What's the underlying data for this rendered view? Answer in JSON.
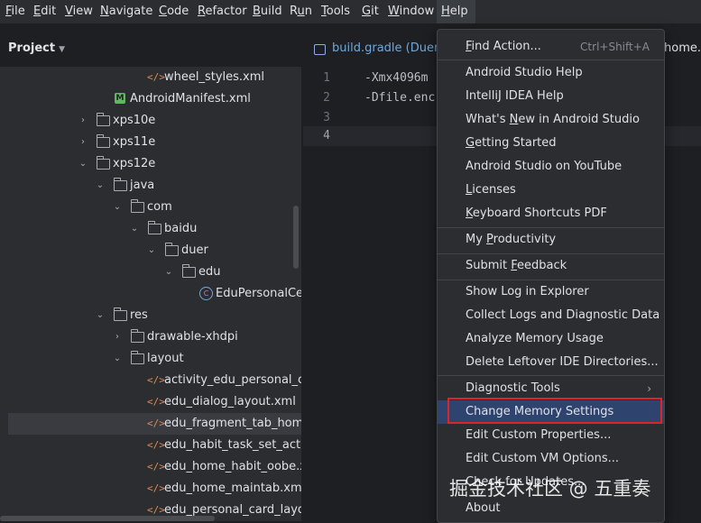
{
  "menubar": {
    "items": [
      {
        "pre": "",
        "mn": "F",
        "post": "ile"
      },
      {
        "pre": "",
        "mn": "E",
        "post": "dit"
      },
      {
        "pre": "",
        "mn": "V",
        "post": "iew"
      },
      {
        "pre": "",
        "mn": "N",
        "post": "avigate"
      },
      {
        "pre": "",
        "mn": "C",
        "post": "ode"
      },
      {
        "pre": "",
        "mn": "R",
        "post": "efactor"
      },
      {
        "pre": "",
        "mn": "B",
        "post": "uild"
      },
      {
        "pre": "R",
        "mn": "u",
        "post": "n"
      },
      {
        "pre": "",
        "mn": "T",
        "post": "ools"
      },
      {
        "pre": "",
        "mn": "G",
        "post": "it"
      },
      {
        "pre": "",
        "mn": "W",
        "post": "indow"
      },
      {
        "pre": "",
        "mn": "H",
        "post": "elp"
      }
    ]
  },
  "project": {
    "title": "Project",
    "tree": [
      {
        "label": "wheel_styles.xml",
        "arrow": "",
        "icon": "xml-file-icon"
      },
      {
        "label": "AndroidManifest.xml",
        "arrow": "",
        "icon": "manifest-icon"
      },
      {
        "label": "xps10e",
        "arrow": "›",
        "icon": "folder-icon"
      },
      {
        "label": "xps11e",
        "arrow": "›",
        "icon": "folder-icon"
      },
      {
        "label": "xps12e",
        "arrow": "⌄",
        "icon": "folder-icon"
      },
      {
        "label": "java",
        "arrow": "⌄",
        "icon": "folder-icon"
      },
      {
        "label": "com",
        "arrow": "⌄",
        "icon": "folder-icon"
      },
      {
        "label": "baidu",
        "arrow": "⌄",
        "icon": "folder-icon"
      },
      {
        "label": "duer",
        "arrow": "⌄",
        "icon": "folder-icon"
      },
      {
        "label": "edu",
        "arrow": "⌄",
        "icon": "folder-icon"
      },
      {
        "label": "EduPersonalCent",
        "arrow": "",
        "icon": "class-icon"
      },
      {
        "label": "res",
        "arrow": "⌄",
        "icon": "folder-icon"
      },
      {
        "label": "drawable-xhdpi",
        "arrow": "›",
        "icon": "folder-icon"
      },
      {
        "label": "layout",
        "arrow": "⌄",
        "icon": "folder-icon"
      },
      {
        "label": "activity_edu_personal_cent",
        "arrow": "",
        "icon": "xml-file-icon"
      },
      {
        "label": "edu_dialog_layout.xml",
        "arrow": "",
        "icon": "xml-file-icon"
      },
      {
        "label": "edu_fragment_tab_home.x",
        "arrow": "",
        "icon": "xml-file-icon"
      },
      {
        "label": "edu_habit_task_set_activity",
        "arrow": "",
        "icon": "xml-file-icon"
      },
      {
        "label": "edu_home_habit_oobe.xml",
        "arrow": "",
        "icon": "xml-file-icon"
      },
      {
        "label": "edu_home_maintab.xml",
        "arrow": "",
        "icon": "xml-file-icon"
      },
      {
        "label": "edu_personal_card_layout_",
        "arrow": "",
        "icon": "xml-file-icon"
      }
    ]
  },
  "editor": {
    "tab_label": "build.gradle (DuerSl",
    "right_tab_label": "home.xm",
    "lines": [
      {
        "num": "1",
        "text": "-Xmx4096m"
      },
      {
        "num": "2",
        "text": "-Dfile.enc"
      },
      {
        "num": "3",
        "text": ""
      },
      {
        "num": "4",
        "text": ""
      }
    ]
  },
  "help_menu": {
    "items": [
      {
        "pre": "",
        "mn": "F",
        "post": "ind Action...",
        "shortcut": "Ctrl+Shift+A"
      },
      {
        "pre": "Android Studio Help",
        "mn": "",
        "post": "",
        "shortcut": ""
      },
      {
        "pre": "IntelliJ IDEA Help",
        "mn": "",
        "post": "",
        "shortcut": ""
      },
      {
        "pre": "What's ",
        "mn": "N",
        "post": "ew in Android Studio",
        "shortcut": ""
      },
      {
        "pre": "",
        "mn": "G",
        "post": "etting Started",
        "shortcut": ""
      },
      {
        "pre": "Android Studio on YouTube",
        "mn": "",
        "post": "",
        "shortcut": ""
      },
      {
        "pre": "",
        "mn": "L",
        "post": "icenses",
        "shortcut": ""
      },
      {
        "pre": "",
        "mn": "K",
        "post": "eyboard Shortcuts PDF",
        "shortcut": ""
      },
      {
        "pre": "My ",
        "mn": "P",
        "post": "roductivity",
        "shortcut": ""
      },
      {
        "pre": "Submit ",
        "mn": "F",
        "post": "eedback",
        "shortcut": ""
      },
      {
        "pre": "Show Log in Explorer",
        "mn": "",
        "post": "",
        "shortcut": ""
      },
      {
        "pre": "Collect Logs and Diagnostic Data",
        "mn": "",
        "post": "",
        "shortcut": ""
      },
      {
        "pre": "Analyze Memory Usage",
        "mn": "",
        "post": "",
        "shortcut": ""
      },
      {
        "pre": "Delete Leftover IDE Directories...",
        "mn": "",
        "post": "",
        "shortcut": ""
      },
      {
        "pre": "Diagnostic Tools",
        "mn": "",
        "post": "",
        "shortcut": ""
      },
      {
        "pre": "Change Memory Settings",
        "mn": "",
        "post": "",
        "shortcut": ""
      },
      {
        "pre": "Edit Custom Properties...",
        "mn": "",
        "post": "",
        "shortcut": ""
      },
      {
        "pre": "Edit Custom VM Options...",
        "mn": "",
        "post": "",
        "shortcut": ""
      },
      {
        "pre": "Check for Updates...",
        "mn": "",
        "post": "",
        "shortcut": ""
      },
      {
        "pre": "About",
        "mn": "",
        "post": "",
        "shortcut": ""
      }
    ]
  },
  "watermark": "掘金技术社区 @ 五重奏",
  "colors": {
    "highlight": "#2e436e",
    "annotation_box": "#d9262a",
    "link_blue": "#6fa8dc"
  }
}
